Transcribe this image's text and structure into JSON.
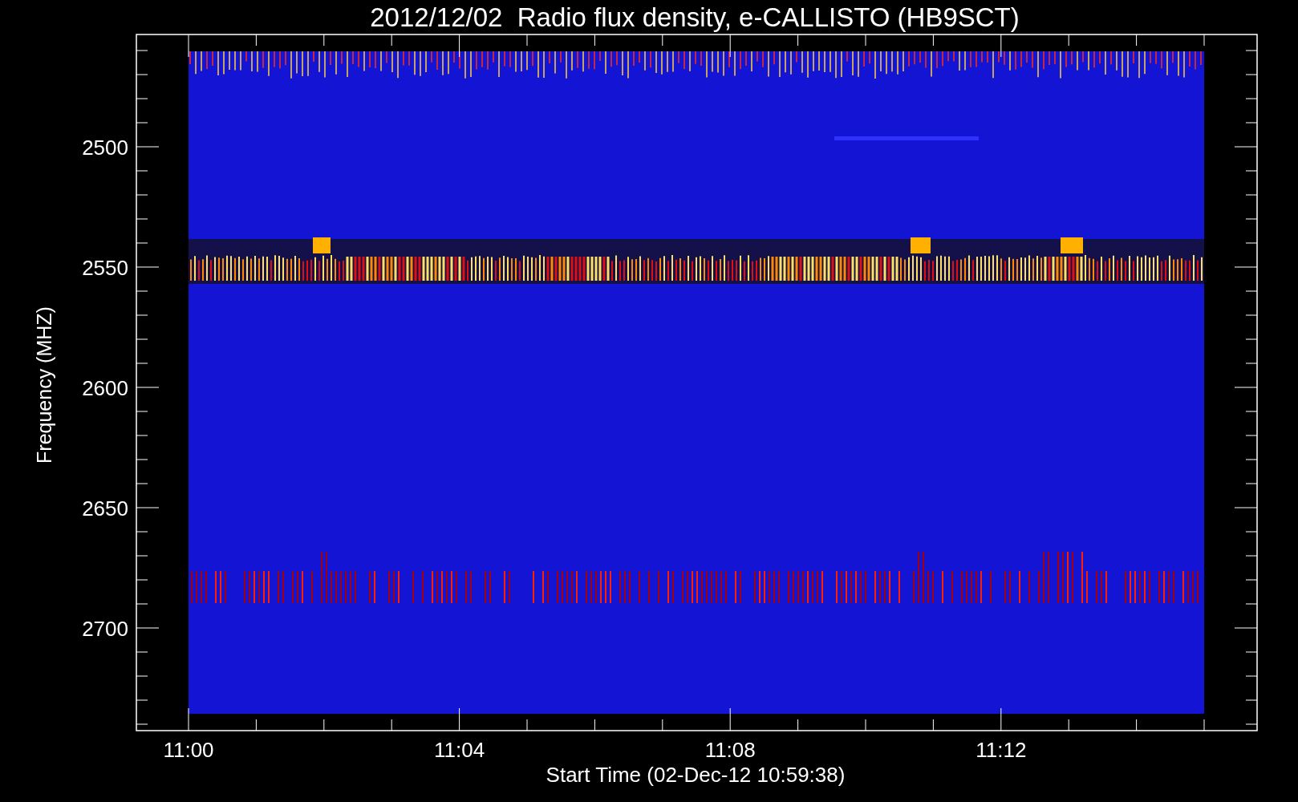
{
  "title": "2012/12/02  Radio flux density, e-CALLISTO (HB9SCT)",
  "y_axis": {
    "label": "Frequency (MHZ)",
    "ticks": [
      "2500",
      "2550",
      "2600",
      "2650",
      "2700"
    ]
  },
  "x_axis": {
    "label": "Start Time (02-Dec-12 10:59:38)",
    "ticks": [
      "11:00",
      "11:04",
      "11:08",
      "11:12"
    ]
  }
}
